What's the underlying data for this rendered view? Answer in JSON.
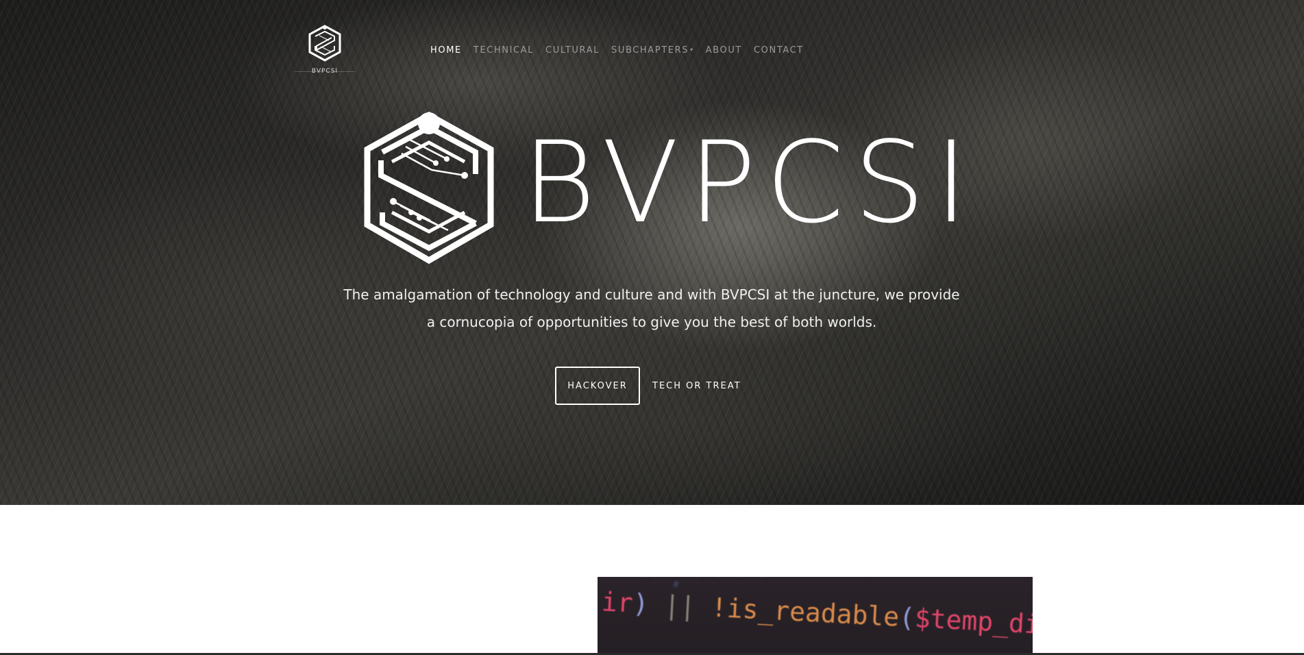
{
  "brand": {
    "name": "BVPCSI",
    "logo_icon": "bvpcsi-hexagon-logo-icon"
  },
  "nav": {
    "items": [
      {
        "label": "HOME",
        "active": true
      },
      {
        "label": "TECHNICAL",
        "active": false
      },
      {
        "label": "CULTURAL",
        "active": false
      },
      {
        "label": "SUBCHAPTERS",
        "active": false,
        "has_dropdown": true
      },
      {
        "label": "ABOUT",
        "active": false
      },
      {
        "label": "CONTACT",
        "active": false
      }
    ],
    "dropdown_caret": "▾"
  },
  "hero": {
    "title": "BVPCSI",
    "tagline_line1": "The amalgamation of technology and culture and with BVPCSI at the juncture, we provide",
    "tagline_line2": "a cornucopia of opportunities to give you the best of both worlds.",
    "primary_button": "HACKOVER",
    "secondary_button": "TECH OR TREAT"
  },
  "code_image": {
    "tokens": [
      {
        "text": "ir",
        "color": "#e0456a"
      },
      {
        "text": ") ",
        "color": "#8f9ad6"
      },
      {
        "text": "|| ",
        "color": "#8a8078"
      },
      {
        "text": "!",
        "color": "#d98a4a"
      },
      {
        "text": "is_readable",
        "color": "#d98a4a"
      },
      {
        "text": "(",
        "color": "#8f9ad6"
      },
      {
        "text": "$temp_dir",
        "color": "#e0456a"
      },
      {
        "text": ")))",
        "color": "#8f9ad6"
      },
      {
        "text": " {",
        "color": "#8f9ad6"
      }
    ]
  },
  "colors": {
    "text_light": "#ffffff",
    "nav_inactive": "#9a9a9a"
  }
}
